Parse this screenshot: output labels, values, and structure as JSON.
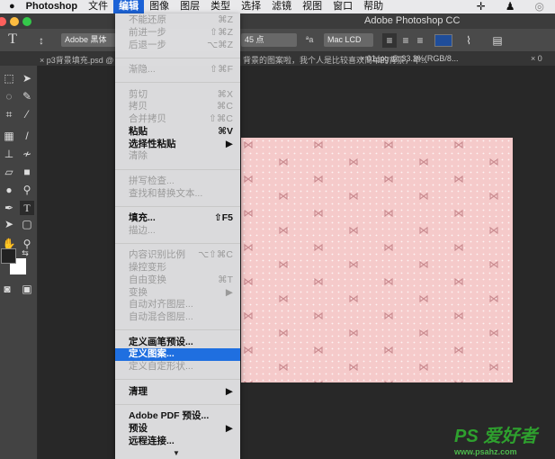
{
  "menubar": {
    "apple": "",
    "app": "Photoshop",
    "items": [
      "文件",
      "编辑",
      "图像",
      "图层",
      "类型",
      "选择",
      "滤镜",
      "视图",
      "窗口",
      "帮助"
    ],
    "active": "编辑"
  },
  "titlebar": {
    "title": "Adobe Photoshop CC"
  },
  "options": {
    "font": "Adobe 黑体 Std",
    "size": "45 点",
    "aa": "Mac LCD",
    "color": "#1f4d9a"
  },
  "tabs": [
    "× p3背景填充.psd @",
    "背景的图案啦，我个人是比较喜欢简单的背景，毕...",
    "× 01.jpg @ 33.3%(RGB/8...",
    "× 0"
  ],
  "menu": {
    "items": [
      {
        "label": "不能还原",
        "shortcut": "⌘Z",
        "enabled": false
      },
      {
        "label": "前进一步",
        "shortcut": "⇧⌘Z",
        "enabled": false
      },
      {
        "label": "后退一步",
        "shortcut": "⌥⌘Z",
        "enabled": false
      },
      {
        "sep": true
      },
      {
        "label": "渐隐...",
        "shortcut": "⇧⌘F",
        "enabled": false
      },
      {
        "sep": true
      },
      {
        "label": "剪切",
        "shortcut": "⌘X",
        "enabled": false
      },
      {
        "label": "拷贝",
        "shortcut": "⌘C",
        "enabled": false
      },
      {
        "label": "合并拷贝",
        "shortcut": "⇧⌘C",
        "enabled": false
      },
      {
        "label": "粘贴",
        "shortcut": "⌘V",
        "enabled": true
      },
      {
        "label": "选择性粘贴",
        "shortcut": "▶",
        "enabled": true
      },
      {
        "label": "清除",
        "shortcut": "",
        "enabled": false
      },
      {
        "sep": true
      },
      {
        "label": "拼写检查...",
        "shortcut": "",
        "enabled": false
      },
      {
        "label": "查找和替换文本...",
        "shortcut": "",
        "enabled": false
      },
      {
        "sep": true
      },
      {
        "label": "填充...",
        "shortcut": "⇧F5",
        "enabled": true
      },
      {
        "label": "描边...",
        "shortcut": "",
        "enabled": false
      },
      {
        "sep": true
      },
      {
        "label": "内容识别比例",
        "shortcut": "⌥⇧⌘C",
        "enabled": false
      },
      {
        "label": "操控变形",
        "shortcut": "",
        "enabled": false
      },
      {
        "label": "自由变换",
        "shortcut": "⌘T",
        "enabled": false
      },
      {
        "label": "变换",
        "shortcut": "▶",
        "enabled": false
      },
      {
        "label": "自动对齐图层...",
        "shortcut": "",
        "enabled": false
      },
      {
        "label": "自动混合图层...",
        "shortcut": "",
        "enabled": false
      },
      {
        "sep": true
      },
      {
        "label": "定义画笔预设...",
        "shortcut": "",
        "enabled": true
      },
      {
        "label": "定义图案...",
        "shortcut": "",
        "enabled": true,
        "highlighted": true
      },
      {
        "label": "定义自定形状...",
        "shortcut": "",
        "enabled": false
      },
      {
        "sep": true
      },
      {
        "label": "清理",
        "shortcut": "▶",
        "enabled": true
      },
      {
        "sep": true
      },
      {
        "label": "Adobe PDF 预设...",
        "shortcut": "",
        "enabled": true
      },
      {
        "label": "预设",
        "shortcut": "▶",
        "enabled": true
      },
      {
        "label": "远程连接...",
        "shortcut": "",
        "enabled": true
      }
    ],
    "more": "▼"
  },
  "canvas": {
    "bg": "#f5caca",
    "bow": "#c98a8f"
  },
  "watermark": {
    "logo": "PS 爱好者",
    "url": "www.psahz.com"
  }
}
